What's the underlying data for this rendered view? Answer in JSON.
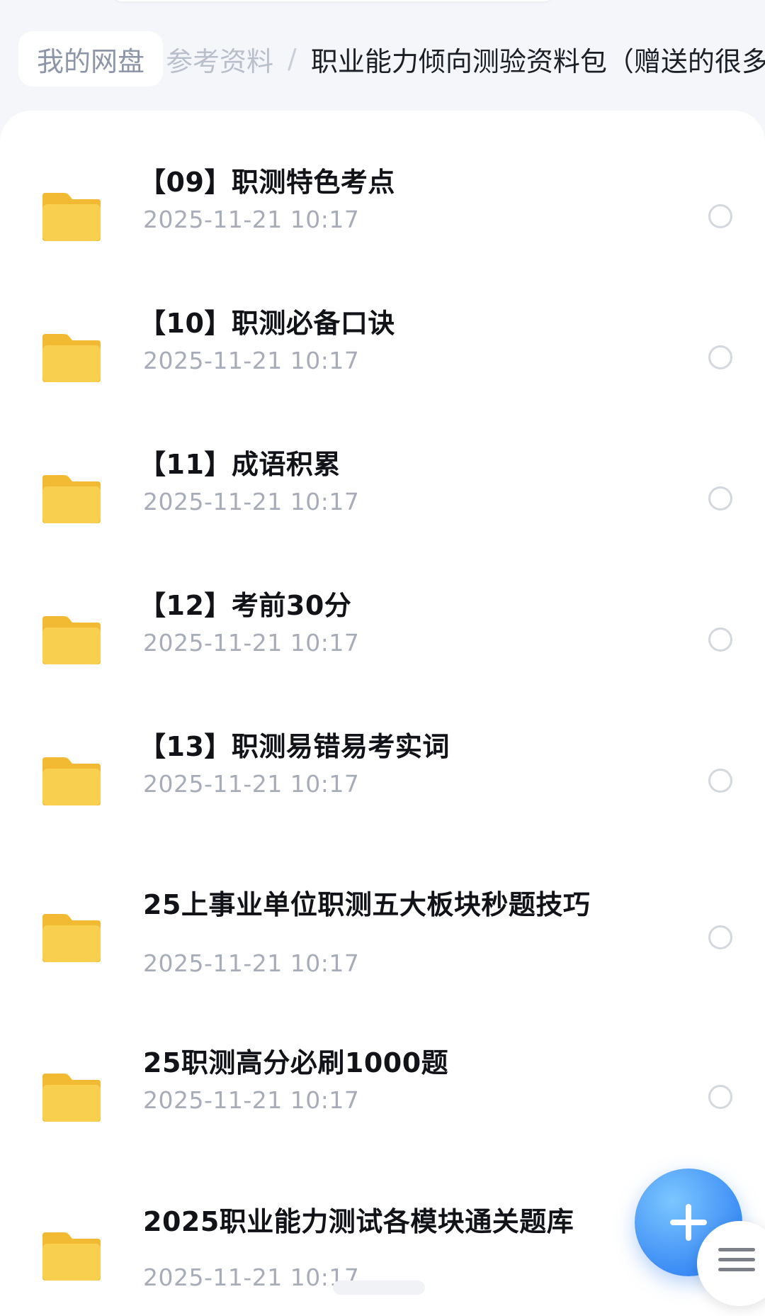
{
  "breadcrumb": {
    "root": "我的网盘",
    "middle": "参考资料",
    "separator": "/",
    "current": "职业能力倾向测验资料包（赠送的很多"
  },
  "files": [
    {
      "name": "【09】职测特色考点",
      "date": "2025-11-21 10:17",
      "icon": "folder-icon"
    },
    {
      "name": "【10】职测必备口诀",
      "date": "2025-11-21 10:17",
      "icon": "folder-icon"
    },
    {
      "name": "【11】成语积累",
      "date": "2025-11-21 10:17",
      "icon": "folder-icon"
    },
    {
      "name": "【12】考前30分",
      "date": "2025-11-21 10:17",
      "icon": "folder-icon"
    },
    {
      "name": "【13】职测易错易考实词",
      "date": "2025-11-21 10:17",
      "icon": "folder-icon"
    },
    {
      "name": "25上事业单位职测五大板块秒题技巧",
      "date": "2025-11-21 10:17",
      "icon": "folder-icon"
    },
    {
      "name": "25职测高分必刷1000题",
      "date": "2025-11-21 10:17",
      "icon": "folder-icon"
    },
    {
      "name": "2025职业能力测试各模块通关题库",
      "date": "2025-11-21 10:17",
      "icon": "folder-icon"
    }
  ],
  "fab": {
    "icon": "plus-icon"
  },
  "menu": {
    "icon": "hamburger-menu-icon"
  },
  "colors": {
    "folder": "#f8cf4f",
    "accent": "#3b8cf5",
    "date_text": "#a7adb8"
  }
}
